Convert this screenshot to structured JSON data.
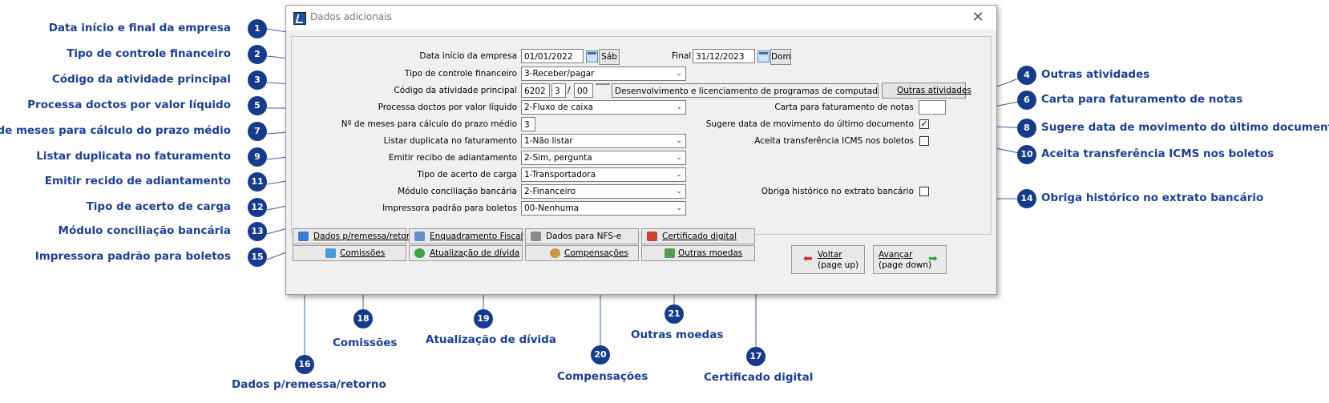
{
  "window": {
    "title": "Dados adicionais"
  },
  "form": {
    "data_inicio_label": "Data início da empresa",
    "data_inicio_value": "01/01/2022",
    "data_inicio_day": "Sáb",
    "final_label": "Final",
    "final_value": "31/12/2023",
    "final_day": "Dom",
    "tipo_controle_label": "Tipo de controle financeiro",
    "tipo_controle_value": "3-Receber/pagar",
    "codigo_atividade_label": "Código da atividade principal",
    "codigo_atividade_p1": "6202",
    "codigo_atividade_p2": "3",
    "codigo_atividade_sep": "/",
    "codigo_atividade_p3": "00",
    "codigo_atividade_desc": "Desenvolvimento e licenciamento de programas de computador c",
    "outras_atividades_btn": "Outras atividades",
    "processa_doctos_label": "Processa doctos por valor líquido",
    "processa_doctos_value": "2-Fluxo de caixa",
    "carta_label": "Carta para faturamento de notas",
    "carta_value": "",
    "meses_label": "Nº de meses para cálculo do prazo médio",
    "meses_value": "3",
    "sugere_label": "Sugere data de movimento do último documento",
    "sugere_checked": "✓",
    "listar_label": "Listar duplicata no faturamento",
    "listar_value": "1-Não listar",
    "aceita_label": "Aceita transferência ICMS nos boletos",
    "emitir_label": "Emitir recibo de adiantamento",
    "emitir_value": "2-Sim, pergunta",
    "tipo_acerto_label": "Tipo de acerto de carga",
    "tipo_acerto_value": "1-Transportadora",
    "modulo_label": "Módulo conciliação bancária",
    "modulo_value": "2-Financeiro",
    "obriga_label": "Obriga histórico no extrato bancário",
    "impressora_label": "Impressora padrão para boletos",
    "impressora_value": "00-Nenhuma"
  },
  "buttons": {
    "remessa": "Dados p/remessa/retorno",
    "enquadramento": "Enquadramento Fiscal",
    "nfse": "Dados para NFS-e",
    "certificado": "Certificado digital",
    "comissoes": "Comissões",
    "atualizacao": "Atualização de dívida",
    "compensacoes": "Compensações",
    "outras_moedas": "Outras moedas",
    "voltar_l1": "Voltar",
    "voltar_l2": "(page up)",
    "avancar_l1": "Avançar",
    "avancar_l2": "(page down)"
  },
  "callouts": {
    "c1": {
      "n": "1",
      "text": "Data início e final da empresa"
    },
    "c2": {
      "n": "2",
      "text": "Tipo de controle financeiro"
    },
    "c3": {
      "n": "3",
      "text": "Código da atividade principal"
    },
    "c4": {
      "n": "4",
      "text": "Outras atividades"
    },
    "c5": {
      "n": "5",
      "text": "Processa doctos por valor líquido"
    },
    "c6": {
      "n": "6",
      "text": "Carta para faturamento de notas"
    },
    "c7": {
      "n": "7",
      "text": "Nº de meses para cálculo do prazo médio"
    },
    "c8": {
      "n": "8",
      "text": "Sugere data de movimento do último documento"
    },
    "c9": {
      "n": "9",
      "text": "Listar duplicata no faturamento"
    },
    "c10": {
      "n": "10",
      "text": "Aceita transferência ICMS nos boletos"
    },
    "c11": {
      "n": "11",
      "text": "Emitir recido de adiantamento"
    },
    "c12": {
      "n": "12",
      "text": "Tipo de acerto de carga"
    },
    "c13": {
      "n": "13",
      "text": "Módulo conciliação bancária"
    },
    "c14": {
      "n": "14",
      "text": "Obriga histórico no extrato bancário"
    },
    "c15": {
      "n": "15",
      "text": "Impressora padrão para boletos"
    },
    "c16": {
      "n": "16",
      "text": "Dados p/remessa/retorno"
    },
    "c17": {
      "n": "17",
      "text": "Certificado digital"
    },
    "c18": {
      "n": "18",
      "text": "Comissões"
    },
    "c19": {
      "n": "19",
      "text": "Atualização de dívida"
    },
    "c20": {
      "n": "20",
      "text": "Compensações"
    },
    "c21": {
      "n": "21",
      "text": "Outras moedas"
    }
  },
  "colors": {
    "callout": "#163a8c",
    "callout_text": "#1b3f91",
    "line": "#3a5fa8"
  }
}
